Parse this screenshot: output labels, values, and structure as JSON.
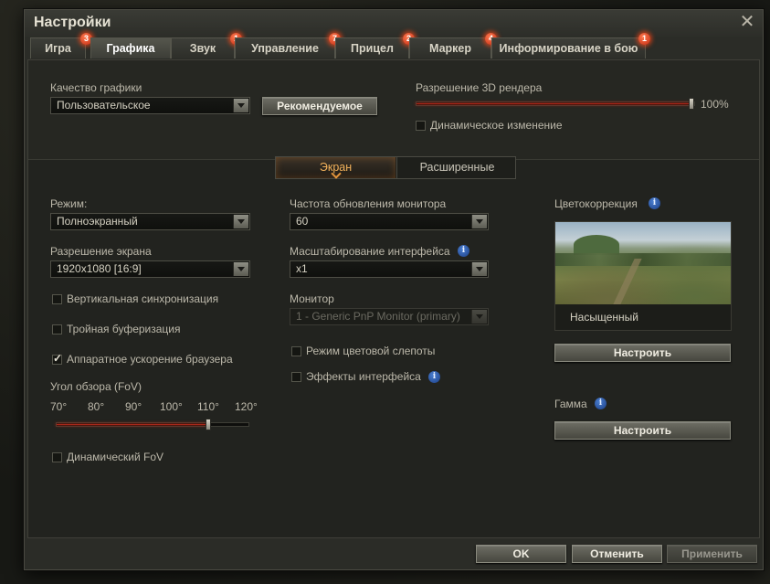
{
  "window": {
    "title": "Настройки"
  },
  "tabs": [
    {
      "label": "Игра",
      "badge": "3"
    },
    {
      "label": "Графика",
      "badge": ""
    },
    {
      "label": "Звук",
      "badge": "1"
    },
    {
      "label": "Управление",
      "badge": "7"
    },
    {
      "label": "Прицел",
      "badge": "2"
    },
    {
      "label": "Маркер",
      "badge": "4"
    },
    {
      "label": "Информирование в бою",
      "badge": "1"
    }
  ],
  "top": {
    "quality_label": "Качество графики",
    "quality_value": "Пользовательское",
    "recommended_button": "Рекомендуемое",
    "render_label": "Разрешение 3D рендера",
    "render_value": "100%",
    "render_level": 1.0,
    "dynamic_label": "Динамическое изменение",
    "dynamic_checked": false
  },
  "subtabs": [
    {
      "label": "Экран"
    },
    {
      "label": "Расширенные"
    }
  ],
  "left": {
    "mode_label": "Режим:",
    "mode_value": "Полноэкранный",
    "resolution_label": "Разрешение экрана",
    "resolution_value": "1920x1080 [16:9]",
    "vsync_label": "Вертикальная синхронизация",
    "vsync_checked": false,
    "triple_label": "Тройная буферизация",
    "triple_checked": false,
    "browser_label": "Аппаратное ускорение браузера",
    "browser_checked": true,
    "fov_label": "Угол обзора (FoV)",
    "fov_ticks": [
      "70°",
      "80°",
      "90°",
      "100°",
      "110°",
      "120°"
    ],
    "fov_value": 110,
    "dynamic_fov_label": "Динамический FoV",
    "dynamic_fov_checked": false
  },
  "middle": {
    "refresh_label": "Частота обновления монитора",
    "refresh_value": "60",
    "scale_label": "Масштабирование интерфейса",
    "scale_value": "x1",
    "monitor_label": "Монитор",
    "monitor_value": "1 - Generic PnP Monitor (primary)",
    "colorblind_label": "Режим цветовой слепоты",
    "colorblind_checked": false,
    "effects_label": "Эффекты интерфейса",
    "effects_checked": false
  },
  "right": {
    "color_label": "Цветокоррекция",
    "preview_caption": "Насыщенный",
    "configure_button": "Настроить",
    "gamma_label": "Гамма",
    "gamma_button": "Настроить"
  },
  "footer": {
    "ok": "OK",
    "cancel": "Отменить",
    "apply": "Применить"
  },
  "colors": {
    "accent": "#e3953c",
    "badge": "#d0301a",
    "info": "#2a5bb0",
    "slider_fill": "#a8281a"
  }
}
